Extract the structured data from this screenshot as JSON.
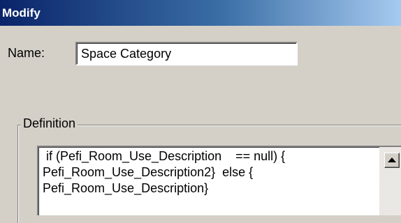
{
  "window": {
    "title": "Modify"
  },
  "name_field": {
    "label": "Name:",
    "value": "Space Category"
  },
  "definition": {
    "group_label": "Definition",
    "text": " if (Pefi_Room_Use_Description    == null) {\nPefi_Room_Use_Description2}  else {\nPefi_Room_Use_Description}"
  },
  "icons": {
    "scroll_up": "arrow-up-icon"
  }
}
